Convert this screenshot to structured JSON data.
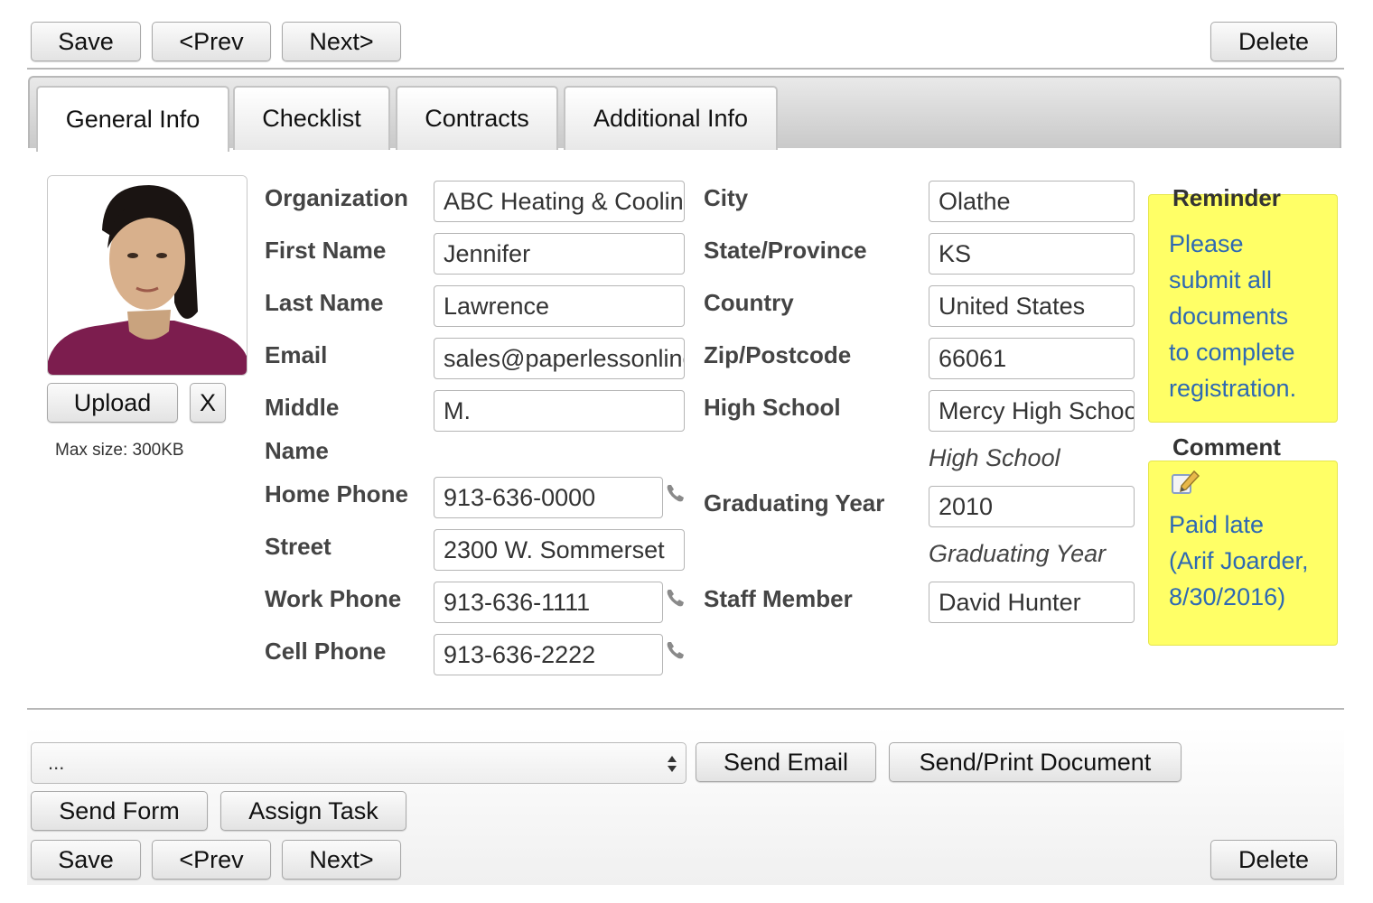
{
  "toolbar": {
    "save": "Save",
    "prev": "<Prev",
    "next": "Next>",
    "delete": "Delete"
  },
  "tabs": [
    "General Info",
    "Checklist",
    "Contracts",
    "Additional Info"
  ],
  "photo": {
    "upload": "Upload",
    "remove": "X",
    "max_size": "Max size: 300KB"
  },
  "left_fields": [
    {
      "label": "Organization",
      "value": "ABC Heating & Cooling"
    },
    {
      "label": "First Name",
      "value": "Jennifer"
    },
    {
      "label": "Last Name",
      "value": "Lawrence"
    },
    {
      "label": "Email",
      "value": "sales@paperlessonline.com"
    },
    {
      "label_line1": "Middle",
      "label_line2": "Name",
      "value": "M."
    },
    {
      "label": "Home Phone",
      "value": "913-636-0000"
    },
    {
      "label": "Street",
      "value": "2300 W. Sommerset"
    },
    {
      "label": "Work Phone",
      "value": "913-636-1111"
    },
    {
      "label": "Cell Phone",
      "value": "913-636-2222"
    }
  ],
  "right_fields": [
    {
      "label": "City",
      "value": "Olathe"
    },
    {
      "label": "State/Province",
      "value": "KS"
    },
    {
      "label": "Country",
      "value": "United States"
    },
    {
      "label": "Zip/Postcode",
      "value": "66061"
    },
    {
      "label": "High School",
      "value": "Mercy High School",
      "hint": "High School"
    },
    {
      "label": "Graduating Year",
      "value": "2010",
      "hint": "Graduating Year"
    },
    {
      "label": "Staff Member",
      "value": "David Hunter"
    }
  ],
  "reminder": {
    "title": "Reminder",
    "lines": [
      "Please",
      "submit all",
      "documents",
      "to complete",
      "registration."
    ]
  },
  "comment": {
    "title": "Comment",
    "lines": [
      "Paid late",
      "(Arif Joarder,",
      "8/30/2016)"
    ]
  },
  "actions": {
    "select_value": "...",
    "send_email": "Send Email",
    "send_print": "Send/Print Document",
    "send_form": "Send Form",
    "assign_task": "Assign Task"
  },
  "colors": {
    "note_bg": "#ffff66",
    "note_text": "#2e69b3"
  }
}
